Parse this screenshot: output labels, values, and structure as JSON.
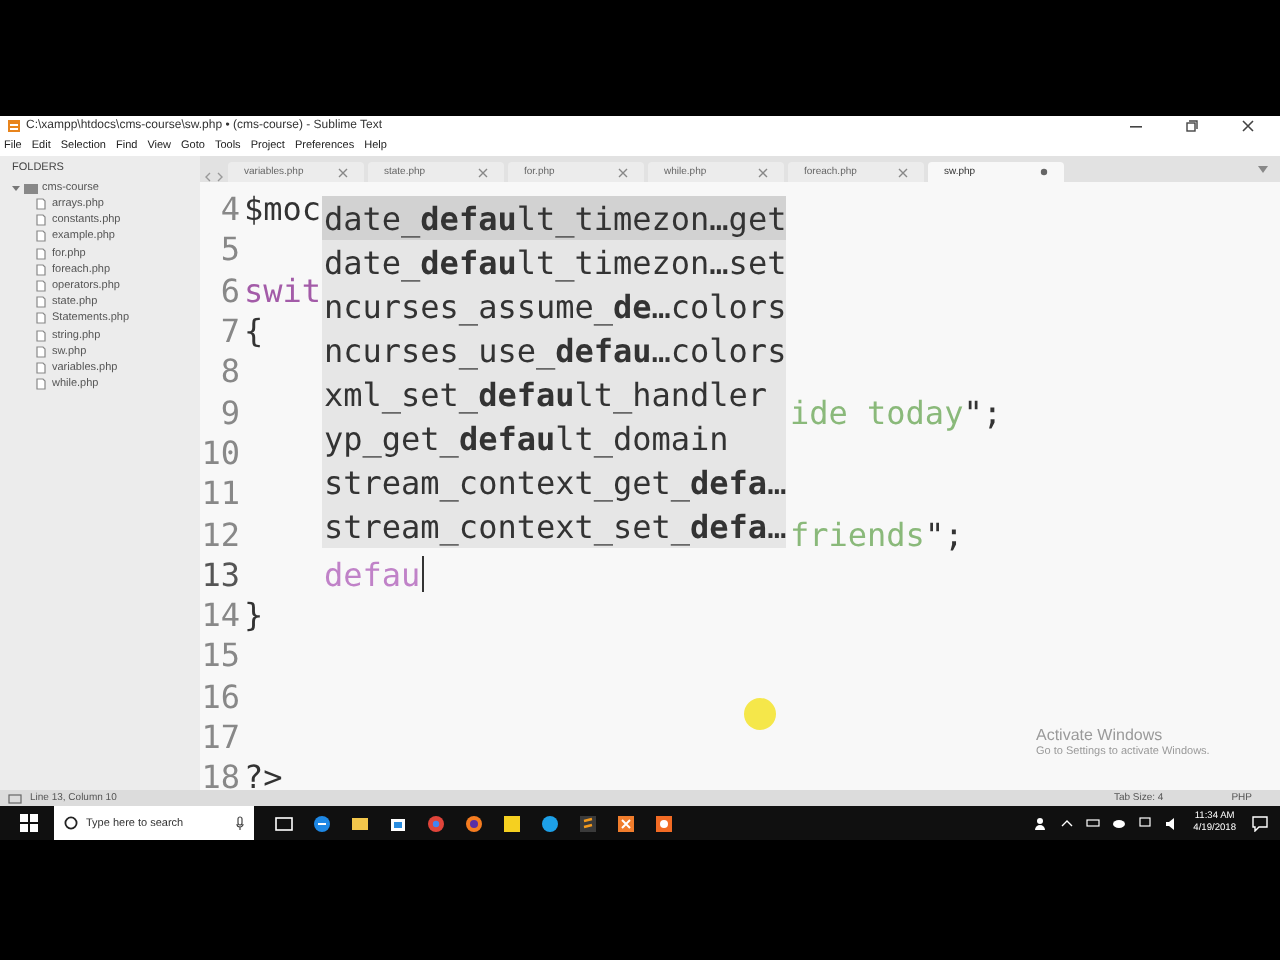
{
  "window": {
    "title": "C:\\xampp\\htdocs\\cms-course\\sw.php • (cms-course) - Sublime Text"
  },
  "menu": [
    "File",
    "Edit",
    "Selection",
    "Find",
    "View",
    "Goto",
    "Tools",
    "Project",
    "Preferences",
    "Help"
  ],
  "tabs": [
    {
      "label": "variables.php",
      "selected": false,
      "modified": false
    },
    {
      "label": "state.php",
      "selected": false,
      "modified": false
    },
    {
      "label": "for.php",
      "selected": false,
      "modified": false
    },
    {
      "label": "while.php",
      "selected": false,
      "modified": false
    },
    {
      "label": "foreach.php",
      "selected": false,
      "modified": false
    },
    {
      "label": "sw.php",
      "selected": true,
      "modified": true
    }
  ],
  "sidebar": {
    "heading": "FOLDERS",
    "folder": {
      "label": "cms-course",
      "expanded": true,
      "children": [
        {
          "label": "arrays.php"
        },
        {
          "label": "constants.php"
        },
        {
          "label": "example.php"
        },
        {
          "label": "for.php"
        },
        {
          "label": "foreach.php"
        },
        {
          "label": "operators.php"
        },
        {
          "label": "state.php"
        },
        {
          "label": "Statements.php"
        },
        {
          "label": "string.php"
        },
        {
          "label": "sw.php"
        },
        {
          "label": "variables.php"
        },
        {
          "label": "while.php"
        }
      ]
    }
  },
  "editor": {
    "lines": [
      {
        "number": "4",
        "segments": [
          {
            "kind": "plain",
            "text": "$moc"
          }
        ]
      },
      {
        "number": "5"
      },
      {
        "number": "6",
        "segments": [
          {
            "kind": "keyword",
            "text": "swit"
          }
        ]
      },
      {
        "number": "7",
        "segments": [
          {
            "kind": "plain",
            "text": "{"
          }
        ]
      },
      {
        "number": "8"
      },
      {
        "number": "9",
        "segments": [
          {
            "kind": "hidden-string",
            "text": "ide today"
          },
          {
            "kind": "plain",
            "text": "\";"
          }
        ]
      },
      {
        "number": "10"
      },
      {
        "number": "11"
      },
      {
        "number": "12",
        "segments": [
          {
            "kind": "hidden-string",
            "text": "friends"
          },
          {
            "kind": "plain",
            "text": "\";"
          }
        ]
      },
      {
        "number": "13",
        "current": true,
        "segments": [
          {
            "kind": "typed",
            "text": "defau"
          }
        ]
      },
      {
        "number": "14",
        "segments": [
          {
            "kind": "plain",
            "text": "}"
          }
        ]
      },
      {
        "number": "15"
      },
      {
        "number": "16"
      },
      {
        "number": "17"
      },
      {
        "number": "18",
        "segments": [
          {
            "kind": "plain",
            "text": "?>"
          }
        ]
      }
    ],
    "completions": [
      {
        "text": "date_**defau**lt_timezon…get",
        "selected": true
      },
      {
        "text": "date_**defau**lt_timezon…set",
        "selected": false
      },
      {
        "text": "ncurses_assume_**de**…colors",
        "selected": false
      },
      {
        "text": "ncurses_use_**defau**…colors",
        "selected": false
      },
      {
        "text": "xml_set_**defau**lt_handler",
        "selected": false
      },
      {
        "text": "yp_get_**defau**lt_domain",
        "selected": false
      },
      {
        "text": "stream_context_get_**defa**…",
        "selected": false
      },
      {
        "text": "stream_context_set_**defa**…",
        "selected": false
      }
    ]
  },
  "activation_notice": {
    "title": "Activate Windows",
    "text": "Go to Settings to activate Windows."
  },
  "status_bar": {
    "position": "Line 13, Column 10",
    "tab_size": "Tab Size: 4",
    "syntax": "PHP"
  },
  "taskbar": {
    "search_placeholder": "Type here to search",
    "time": "11:34 AM",
    "date": "4/19/2018"
  }
}
